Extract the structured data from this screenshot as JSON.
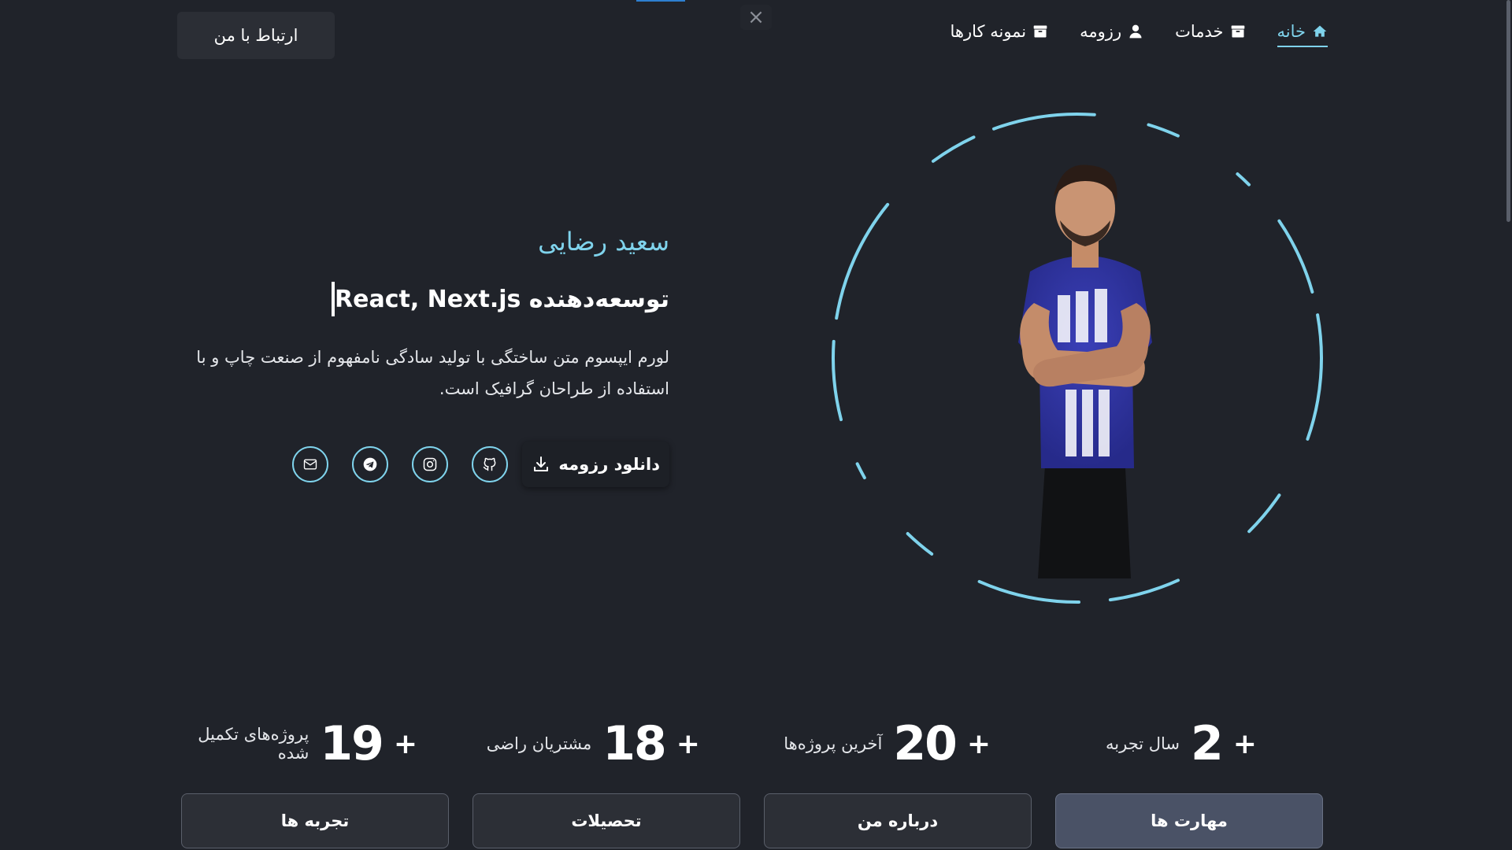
{
  "header": {
    "contact_label": "ارتباط با من",
    "close_glyph": "×",
    "nav": [
      {
        "label": "خانه",
        "icon": "home-icon",
        "active": true
      },
      {
        "label": "خدمات",
        "icon": "archive-icon",
        "active": false
      },
      {
        "label": "رزومه",
        "icon": "user-icon",
        "active": false
      },
      {
        "label": "نمونه کارها",
        "icon": "archive-icon",
        "active": false
      }
    ]
  },
  "hero": {
    "name": "سعید رضایی",
    "role": "توسعه‌دهنده React, Next.js",
    "description": "لورم ایپسوم متن ساختگی با تولید سادگی نامفهوم از صنعت چاپ و با استفاده از طراحان گرافیک است.",
    "download_label": "دانلود رزومه",
    "socials": [
      "github-icon",
      "instagram-icon",
      "telegram-icon",
      "email-icon"
    ]
  },
  "stats": [
    {
      "plus": "+",
      "number": "2",
      "label": "سال تجربه"
    },
    {
      "plus": "+",
      "number": "20",
      "label": "آخرین پروژه‌ها"
    },
    {
      "plus": "+",
      "number": "18",
      "label": "مشتریان راضی"
    },
    {
      "plus": "+",
      "number": "19",
      "label": "پروژه‌های تکمیل شده"
    }
  ],
  "tabs": [
    {
      "label": "مهارت ها",
      "active": true
    },
    {
      "label": "درباره من",
      "active": false
    },
    {
      "label": "تحصیلات",
      "active": false
    },
    {
      "label": "تجربه ها",
      "active": false
    }
  ],
  "colors": {
    "background": "#20232a",
    "accent": "#7fd3ec",
    "button": "#2b2e35",
    "tab_active": "#4a5266"
  }
}
